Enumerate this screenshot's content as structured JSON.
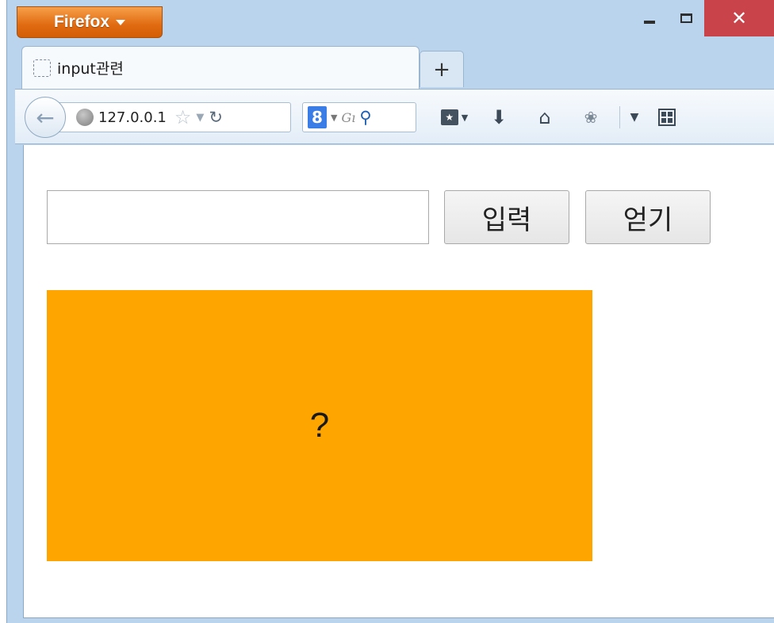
{
  "browser": {
    "menu_button": "Firefox",
    "tab_title": "input관련",
    "new_tab_label": "+",
    "url": "127.0.0.1",
    "search_engine_label": "8",
    "search_placeholder": "Gı",
    "window_controls": {
      "close_label": "✕"
    }
  },
  "page": {
    "input_value": "",
    "input_button_label": "입력",
    "get_button_label": "얻기",
    "display_text": "?",
    "display_color": "#ffa500"
  },
  "icons": {
    "back": "back-arrow-icon",
    "globe": "globe-icon",
    "star": "bookmark-star-icon",
    "reload": "reload-icon",
    "search": "magnifier-icon",
    "bookmarks": "bookmarks-menu-icon",
    "download": "download-arrow-icon",
    "home": "home-icon",
    "addon": "addon-icon",
    "panel": "panel-icon"
  },
  "colors": {
    "firefox_button": "#e06a10",
    "close_button": "#c9434b",
    "chrome_frame": "#b9d4ec"
  }
}
